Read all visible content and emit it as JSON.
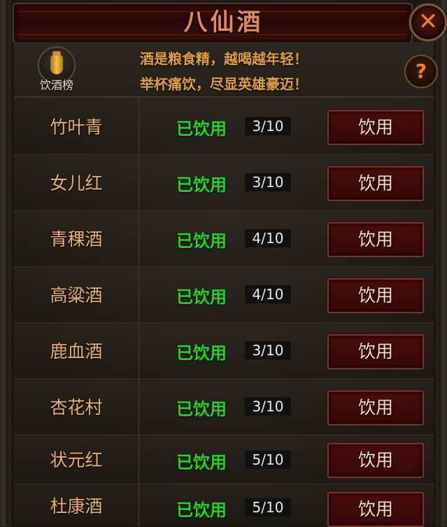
{
  "title": "八仙酒",
  "close_icon": "✕",
  "help_icon": "?",
  "ranking_label": "饮酒榜",
  "motto": [
    "酒是粮食精，越喝越年轻！",
    "举杯痛饮，尽显英雄豪迈！"
  ],
  "rows": [
    {
      "name": "竹叶青",
      "status": "已饮用",
      "count": "3/10",
      "button": "饮用"
    },
    {
      "name": "女儿红",
      "status": "已饮用",
      "count": "3/10",
      "button": "饮用"
    },
    {
      "name": "青稞酒",
      "status": "已饮用",
      "count": "4/10",
      "button": "饮用"
    },
    {
      "name": "高粱酒",
      "status": "已饮用",
      "count": "4/10",
      "button": "饮用"
    },
    {
      "name": "鹿血酒",
      "status": "已饮用",
      "count": "3/10",
      "button": "饮用"
    },
    {
      "name": "杏花村",
      "status": "已饮用",
      "count": "3/10",
      "button": "饮用"
    },
    {
      "name": "状元红",
      "status": "已饮用",
      "count": "5/10",
      "button": "饮用"
    },
    {
      "name": "杜康酒",
      "status": "已饮用",
      "count": "5/10",
      "button": "饮用"
    }
  ]
}
